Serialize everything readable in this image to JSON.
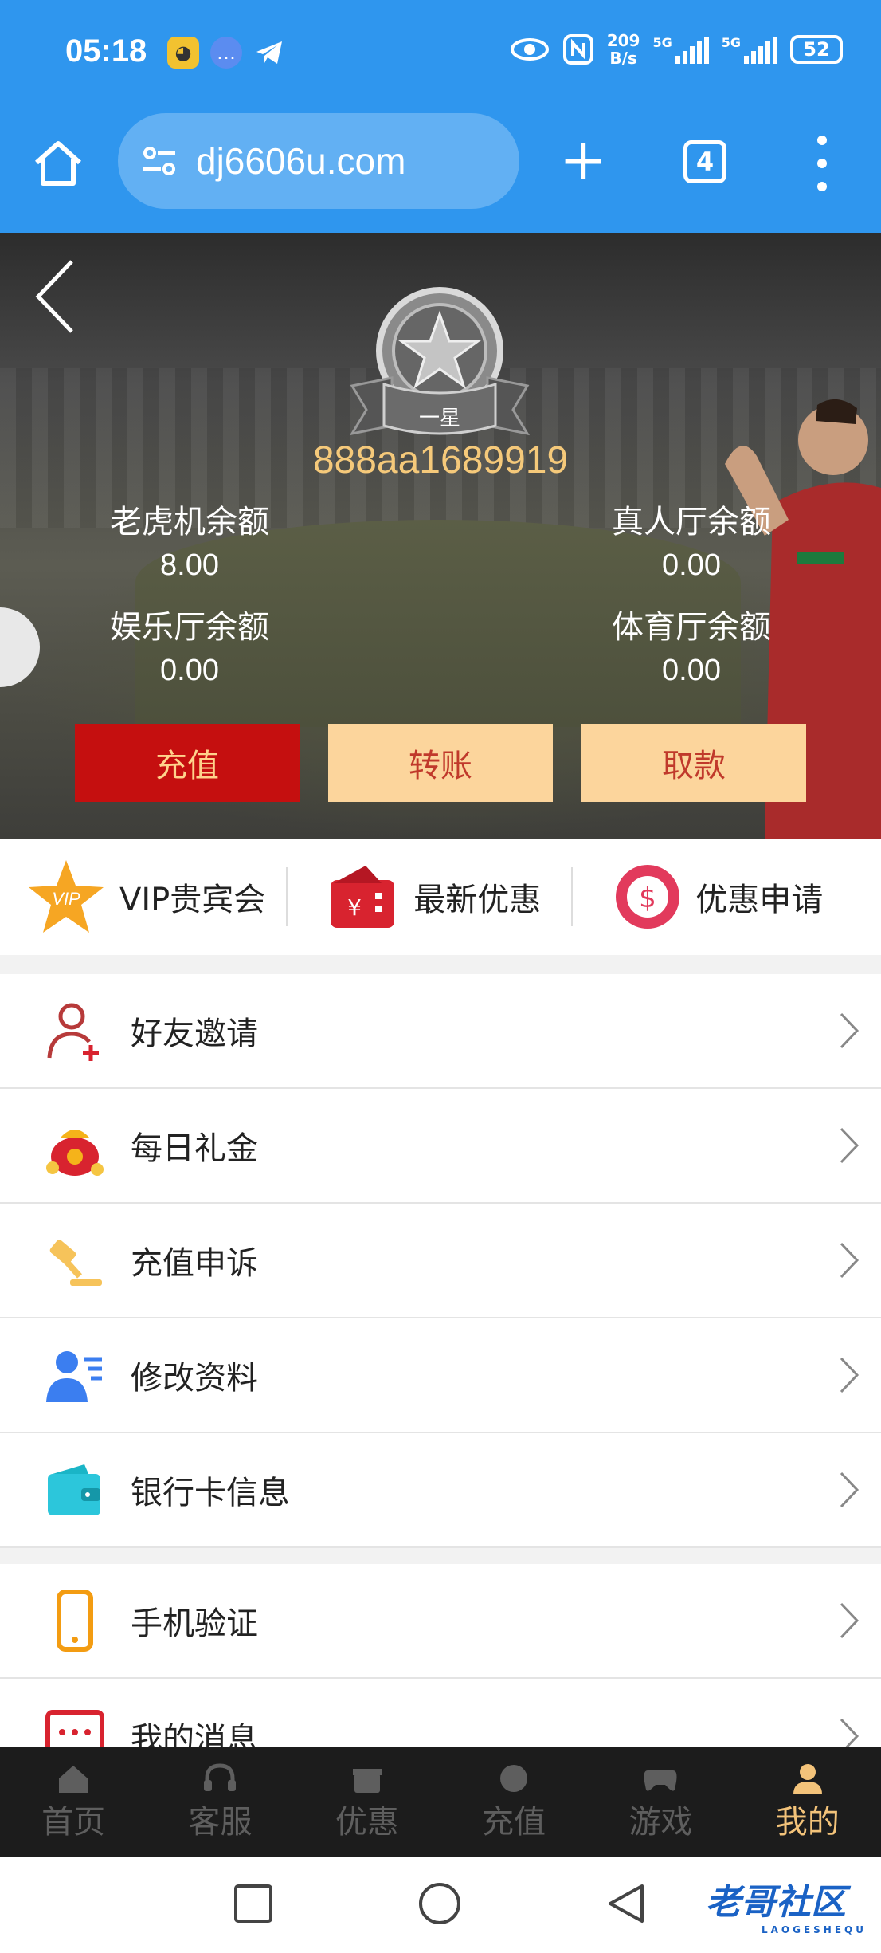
{
  "status": {
    "time": "05:18",
    "net_speed_top": "209",
    "net_speed_unit": "B/s",
    "sim1": "5G",
    "sim2": "5G",
    "battery": "52"
  },
  "browser": {
    "url": "dj6606u.com",
    "tab_count": "4"
  },
  "profile": {
    "level": "一星",
    "username": "888aa1689919",
    "balances": [
      {
        "label": "老虎机余额",
        "value": "8.00"
      },
      {
        "label": "真人厅余额",
        "value": "0.00"
      },
      {
        "label": "娱乐厅余额",
        "value": "0.00"
      },
      {
        "label": "体育厅余额",
        "value": "0.00"
      }
    ],
    "actions": {
      "deposit": "充值",
      "transfer": "转账",
      "withdraw": "取款"
    }
  },
  "quick": [
    {
      "label": "VIP贵宾会",
      "icon": "vip-star-icon"
    },
    {
      "label": "最新优惠",
      "icon": "red-envelope-icon"
    },
    {
      "label": "优惠申请",
      "icon": "dollar-chip-icon"
    }
  ],
  "menu": [
    {
      "label": "好友邀请",
      "icon": "add-user-icon"
    },
    {
      "label": "每日礼金",
      "icon": "money-bag-icon"
    },
    {
      "label": "充值申诉",
      "icon": "gavel-icon"
    },
    {
      "label": "修改资料",
      "icon": "user-edit-icon"
    },
    {
      "label": "银行卡信息",
      "icon": "wallet-icon"
    },
    {
      "label": "手机验证",
      "icon": "phone-icon"
    },
    {
      "label": "我的消息",
      "icon": "message-icon"
    }
  ],
  "nav": [
    {
      "label": "首页",
      "icon": "home-icon"
    },
    {
      "label": "客服",
      "icon": "headset-icon"
    },
    {
      "label": "优惠",
      "icon": "gift-icon"
    },
    {
      "label": "充值",
      "icon": "deposit-icon"
    },
    {
      "label": "游戏",
      "icon": "gamepad-icon"
    },
    {
      "label": "我的",
      "icon": "user-icon"
    }
  ],
  "watermark": {
    "title": "老哥社区",
    "sub": "LAOGESHEQU"
  },
  "colors": {
    "browser_blue": "#2f96ee",
    "accent_gold": "#f3c37a",
    "deposit_red": "#c50f0f",
    "tan": "#fcd59c"
  }
}
